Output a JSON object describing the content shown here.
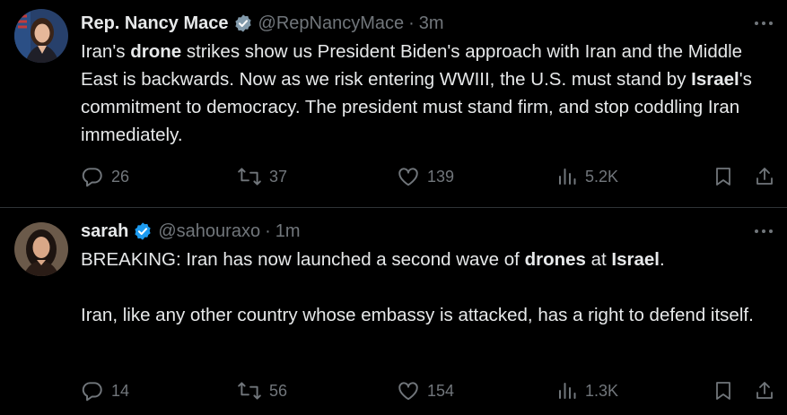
{
  "tweets": [
    {
      "name": "Rep. Nancy Mace",
      "handle": "@RepNancyMace",
      "separator": "·",
      "time": "3m",
      "badge_color": "#829aab",
      "body_paragraphs": [
        [
          {
            "text": "Iran's ",
            "bold": false
          },
          {
            "text": "drone",
            "bold": true
          },
          {
            "text": " strikes show us President Biden's approach with Iran and the Middle East is backwards. Now as we risk entering WWIII, the U.S. must stand by ",
            "bold": false
          },
          {
            "text": "Israel",
            "bold": true
          },
          {
            "text": "'s commitment to democracy. The president must stand firm, and stop coddling Iran immediately.",
            "bold": false
          }
        ]
      ],
      "replies": "26",
      "reposts": "37",
      "likes": "139",
      "views": "5.2K"
    },
    {
      "name": "sarah",
      "handle": "@sahouraxo",
      "separator": "·",
      "time": "1m",
      "badge_color": "#1d9bf0",
      "body_paragraphs": [
        [
          {
            "text": "BREAKING: Iran has now launched a second wave of ",
            "bold": false
          },
          {
            "text": "drones",
            "bold": true
          },
          {
            "text": " at ",
            "bold": false
          },
          {
            "text": "Israel",
            "bold": true
          },
          {
            "text": ".",
            "bold": false
          }
        ],
        [
          {
            "text": "Iran, like any other country whose embassy is attacked, has a right to defend itself.",
            "bold": false
          }
        ]
      ],
      "replies": "14",
      "reposts": "56",
      "likes": "154",
      "views": "1.3K"
    }
  ],
  "icons": {
    "more": "more-horizontal-icon",
    "reply": "reply-icon",
    "repost": "repost-icon",
    "like": "heart-icon",
    "views": "views-chart-icon",
    "bookmark": "bookmark-icon",
    "share": "share-icon",
    "verified": "verified-badge-icon"
  },
  "colors": {
    "background": "#000000",
    "text": "#e7e9ea",
    "muted": "#71767b",
    "divider": "#2f3336"
  }
}
